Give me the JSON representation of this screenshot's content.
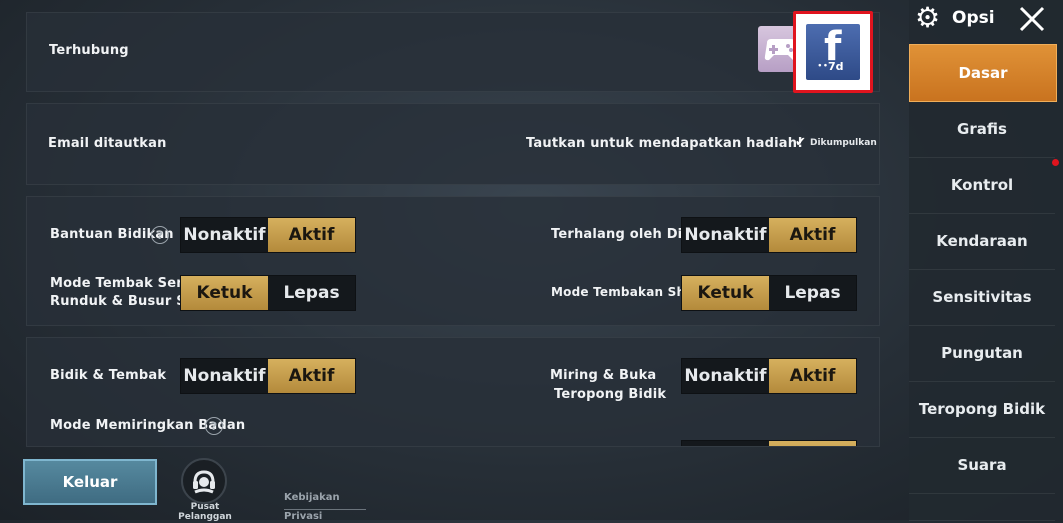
{
  "sections": {
    "connection": {
      "label": "Terhubung",
      "fb_badge": "7d"
    },
    "email": {
      "label": "Email ditautkan",
      "reward_text": "Tautkan untuk mendapatkan hadiah!",
      "collected_text": "Dikumpulkan"
    },
    "aim": {
      "aim_assist": {
        "label": "Bantuan Bidikan",
        "off": "Nonaktif",
        "on": "Aktif",
        "selected": "Aktif"
      },
      "wall_block": {
        "label": "Terhalang oleh Dinding",
        "off": "Nonaktif",
        "on": "Aktif",
        "selected": "Aktif"
      },
      "sniper_mode": {
        "label_line1": "Mode Tembak Senapan",
        "label_line2": "Runduk & Busur Silang",
        "tap": "Ketuk",
        "release": "Lepas",
        "selected": "Ketuk"
      },
      "shotgun_mode": {
        "label": "Mode Tembakan Shotgun",
        "tap": "Ketuk",
        "release": "Lepas",
        "selected": "Ketuk"
      }
    },
    "shoot": {
      "aim_shoot": {
        "label": "Bidik & Tembak",
        "off": "Nonaktif",
        "on": "Aktif",
        "selected": "Aktif"
      },
      "peek_scope": {
        "label_line1": "Miring & Buka",
        "label_line2": "Teropong Bidik",
        "off": "Nonaktif",
        "on": "Aktif",
        "selected": "Aktif"
      },
      "lean_mode": {
        "label": "Mode Memiringkan Badan"
      }
    }
  },
  "footer": {
    "exit_label": "Keluar",
    "support_label": "Pusat Pelanggan",
    "privacy_label": "Kebijakan Privasi"
  },
  "sidebar": {
    "title": "Opsi",
    "items": [
      {
        "label": "Dasar",
        "active": true
      },
      {
        "label": "Grafis"
      },
      {
        "label": "Kontrol"
      },
      {
        "label": "Kendaraan"
      },
      {
        "label": "Sensitivitas"
      },
      {
        "label": "Pungutan"
      },
      {
        "label": "Teropong Bidik"
      },
      {
        "label": "Suara"
      }
    ]
  },
  "colors": {
    "accent_gold": "#c9a14f",
    "active_tab_orange": "#d98530",
    "highlight_red": "#e0141e",
    "facebook_blue": "#3b5998",
    "exit_button": "#4a7d97"
  }
}
